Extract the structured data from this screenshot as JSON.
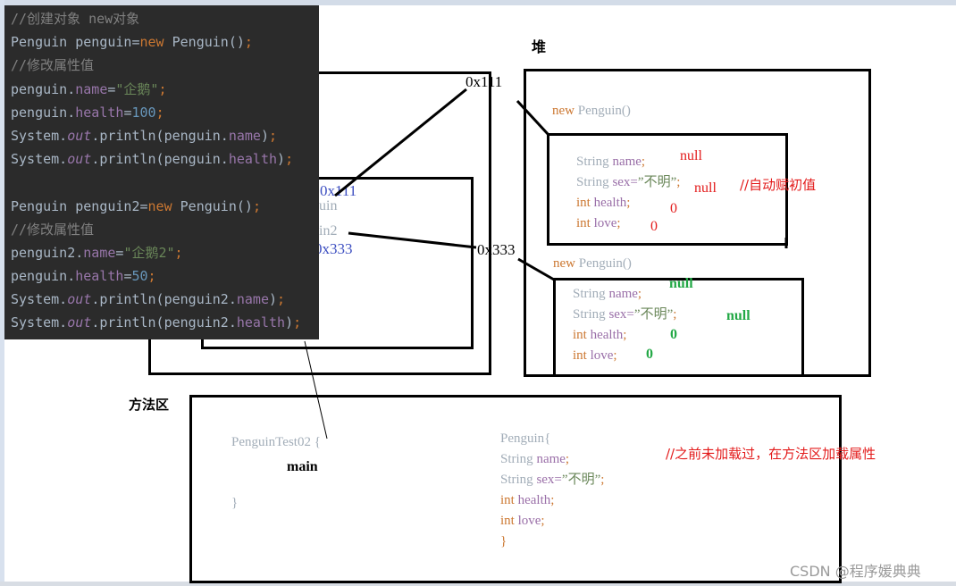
{
  "code_panel": {
    "lines": [
      {
        "tokens": [
          {
            "t": "//创建对象 new对象",
            "c": "comment"
          }
        ]
      },
      {
        "tokens": [
          {
            "t": "Penguin penguin=",
            "c": "plain"
          },
          {
            "t": "new",
            "c": "kw"
          },
          {
            "t": " Penguin()",
            "c": "plain"
          },
          {
            "t": ";",
            "c": "punct"
          }
        ]
      },
      {
        "tokens": [
          {
            "t": "//修改属性值",
            "c": "comment"
          }
        ]
      },
      {
        "tokens": [
          {
            "t": "penguin.",
            "c": "plain"
          },
          {
            "t": "name",
            "c": "field"
          },
          {
            "t": "=",
            "c": "plain"
          },
          {
            "t": "\"企鹅\"",
            "c": "str"
          },
          {
            "t": ";",
            "c": "punct"
          }
        ]
      },
      {
        "tokens": [
          {
            "t": "penguin.",
            "c": "plain"
          },
          {
            "t": "health",
            "c": "field"
          },
          {
            "t": "=",
            "c": "plain"
          },
          {
            "t": "100",
            "c": "num"
          },
          {
            "t": ";",
            "c": "punct"
          }
        ]
      },
      {
        "tokens": [
          {
            "t": "System.",
            "c": "plain"
          },
          {
            "t": "out",
            "c": "static"
          },
          {
            "t": ".println(penguin.",
            "c": "plain"
          },
          {
            "t": "name",
            "c": "field"
          },
          {
            "t": ")",
            "c": "plain"
          },
          {
            "t": ";",
            "c": "punct"
          }
        ]
      },
      {
        "tokens": [
          {
            "t": "System.",
            "c": "plain"
          },
          {
            "t": "out",
            "c": "static"
          },
          {
            "t": ".println(penguin.",
            "c": "plain"
          },
          {
            "t": "health",
            "c": "field"
          },
          {
            "t": ")",
            "c": "plain"
          },
          {
            "t": ";",
            "c": "punct"
          }
        ]
      },
      {
        "tokens": []
      },
      {
        "tokens": [
          {
            "t": "Penguin penguin2=",
            "c": "plain"
          },
          {
            "t": "new",
            "c": "kw"
          },
          {
            "t": " Penguin()",
            "c": "plain"
          },
          {
            "t": ";",
            "c": "punct"
          }
        ]
      },
      {
        "tokens": [
          {
            "t": "//修改属性值",
            "c": "comment"
          }
        ]
      },
      {
        "tokens": [
          {
            "t": "penguin2.",
            "c": "plain"
          },
          {
            "t": "name",
            "c": "field"
          },
          {
            "t": "=",
            "c": "plain"
          },
          {
            "t": "\"企鹅2\"",
            "c": "str"
          },
          {
            "t": ";",
            "c": "punct"
          }
        ]
      },
      {
        "tokens": [
          {
            "t": "penguin.",
            "c": "plain"
          },
          {
            "t": "health",
            "c": "field"
          },
          {
            "t": "=",
            "c": "plain"
          },
          {
            "t": "50",
            "c": "num"
          },
          {
            "t": ";",
            "c": "punct"
          }
        ]
      },
      {
        "tokens": [
          {
            "t": "System.",
            "c": "plain"
          },
          {
            "t": "out",
            "c": "static"
          },
          {
            "t": ".println(penguin2.",
            "c": "plain"
          },
          {
            "t": "name",
            "c": "field"
          },
          {
            "t": ")",
            "c": "plain"
          },
          {
            "t": ";",
            "c": "punct"
          }
        ]
      },
      {
        "tokens": [
          {
            "t": "System.",
            "c": "plain"
          },
          {
            "t": "out",
            "c": "static"
          },
          {
            "t": ".println(penguin2.",
            "c": "plain"
          },
          {
            "t": "health",
            "c": "field"
          },
          {
            "t": ")",
            "c": "plain"
          },
          {
            "t": ";",
            "c": "punct"
          }
        ]
      }
    ]
  },
  "stack": {
    "ref1_value": "0x111",
    "ref1_name_fragment": "uin",
    "ref2_name_fragment": "in2",
    "ref2_value": "0x333"
  },
  "heap": {
    "label": "堆",
    "addr1": "0x111",
    "addr2": "0x333",
    "object1": {
      "ctor_kw": "new",
      "ctor_name": " Penguin()",
      "fields": {
        "name_type": "String",
        "name_field": " name",
        "name_semi": ";",
        "sex_type": "String",
        "sex_field": " sex=",
        "sex_value": "”不明”",
        "sex_semi": ";",
        "health_type": "int",
        "health_field": " health",
        "health_semi": ";",
        "love_type": "int",
        "love_field": " love",
        "love_semi": ";"
      },
      "defaults": {
        "name": "null",
        "sex": "null",
        "health": "0",
        "love": "0"
      },
      "comment": "//自动赋初值"
    },
    "object2": {
      "ctor_kw": "new",
      "ctor_name": " Penguin()",
      "fields": {
        "name_type": "String",
        "name_field": " name",
        "name_semi": ";",
        "sex_type": "String",
        "sex_field": " sex=",
        "sex_value": "”不明”",
        "sex_semi": ";",
        "health_type": "int",
        "health_field": " health",
        "health_semi": ";",
        "love_type": "int",
        "love_field": " love",
        "love_semi": ";"
      },
      "defaults": {
        "name": "null",
        "sex": "null",
        "health": "0",
        "love": "0"
      }
    }
  },
  "method_area": {
    "label": "方法区",
    "class_header": "PenguinTest02 {",
    "method": "main",
    "class_close": "}",
    "penguin_class": {
      "header": "Penguin{",
      "name_type": "String",
      "name_field": " name",
      "name_semi": ";",
      "sex_type": "String",
      "sex_field": " sex=",
      "sex_value": "”不明”",
      "sex_semi": ";",
      "health_type": "int",
      "health_field": " health",
      "health_semi": ";",
      "love_type": "int",
      "love_field": " love",
      "love_semi": ";",
      "close": "}"
    },
    "comment": "//之前未加载过，在方法区加载属性"
  },
  "watermark": "CSDN @程序媛典典"
}
